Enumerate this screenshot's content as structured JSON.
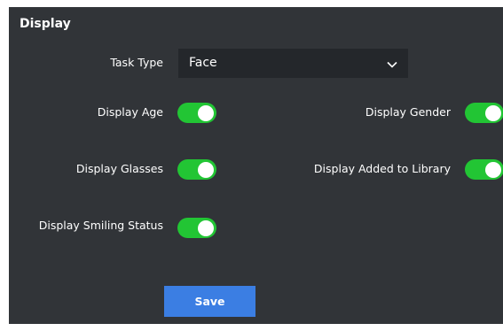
{
  "panel": {
    "title": "Display"
  },
  "task_type": {
    "label": "Task Type",
    "value": "Face",
    "icon": "chevron-down-icon"
  },
  "toggles": {
    "display_age": {
      "label": "Display Age",
      "on": true
    },
    "display_gender": {
      "label": "Display Gender",
      "on": true
    },
    "display_glasses": {
      "label": "Display Glasses",
      "on": true
    },
    "display_added_to_library": {
      "label": "Display Added to Library",
      "on": true
    },
    "display_smiling_status": {
      "label": "Display Smiling Status",
      "on": true
    }
  },
  "actions": {
    "save_label": "Save"
  },
  "colors": {
    "panel_bg": "#313438",
    "select_bg": "#24272b",
    "toggle_on": "#22c534",
    "button": "#3b7ee3",
    "text": "#ffffff"
  }
}
